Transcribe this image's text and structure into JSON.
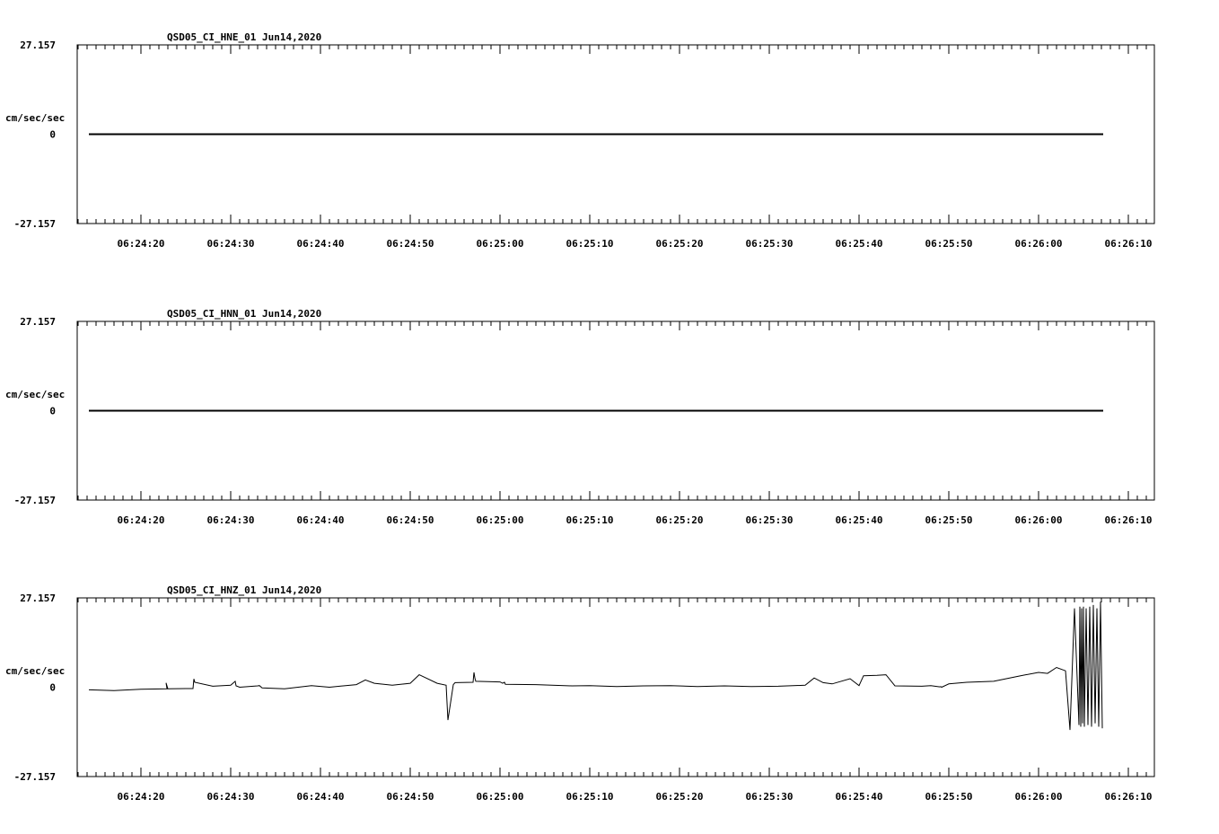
{
  "chart_data": [
    {
      "type": "line",
      "title": "QSD05_CI_HNE_01  Jun14,2020",
      "ylabel": "cm/sec/sec",
      "ylim": [
        -27.157,
        27.157
      ],
      "y_ticks": [
        "27.157",
        "0",
        "-27.157"
      ],
      "x_ticks": [
        "06:24:20",
        "06:24:30",
        "06:24:40",
        "06:24:50",
        "06:25:00",
        "06:25:10",
        "06:25:20",
        "06:25:30",
        "06:25:40",
        "06:25:50",
        "06:26:00",
        "06:26:10"
      ],
      "series": [
        {
          "x_sec": [
            -5.8,
            107.2
          ],
          "values": [
            0,
            0
          ]
        }
      ]
    },
    {
      "type": "line",
      "title": "QSD05_CI_HNN_01  Jun14,2020",
      "ylabel": "cm/sec/sec",
      "ylim": [
        -27.157,
        27.157
      ],
      "y_ticks": [
        "27.157",
        "0",
        "-27.157"
      ],
      "x_ticks": [
        "06:24:20",
        "06:24:30",
        "06:24:40",
        "06:24:50",
        "06:25:00",
        "06:25:10",
        "06:25:20",
        "06:25:30",
        "06:25:40",
        "06:25:50",
        "06:26:00",
        "06:26:10"
      ],
      "series": [
        {
          "x_sec": [
            -5.8,
            107.2
          ],
          "values": [
            0,
            0
          ]
        }
      ]
    },
    {
      "type": "line",
      "title": "QSD05_CI_HNZ_01  Jun14,2020",
      "ylabel": "cm/sec/sec",
      "ylim": [
        -27.157,
        27.157
      ],
      "y_ticks": [
        "27.157",
        "0",
        "-27.157"
      ],
      "x_ticks": [
        "06:24:20",
        "06:24:30",
        "06:24:40",
        "06:24:50",
        "06:25:00",
        "06:25:10",
        "06:25:20",
        "06:25:30",
        "06:25:40",
        "06:25:50",
        "06:26:00",
        "06:26:10"
      ],
      "series": [
        {
          "x_sec": [
            -5.8,
            -3.0,
            0.0,
            3.0,
            2.8,
            2.9,
            3.0,
            5.0,
            5.8,
            5.9,
            6.0,
            8.0,
            10.0,
            10.5,
            10.6,
            11.0,
            13.0,
            13.2,
            13.5,
            16.0,
            19.0,
            21.0,
            24.0,
            25.0,
            26.0,
            28.0,
            30.0,
            31.0,
            33.0,
            34.0,
            34.2,
            34.8,
            35.0,
            37.0,
            37.1,
            37.2,
            37.3,
            40.0,
            40.3,
            40.5,
            40.6,
            44.0,
            48.0,
            50.0,
            53.0,
            56.0,
            59.0,
            62.0,
            65.0,
            68.0,
            71.0,
            72.0,
            74.0,
            75.0,
            76.0,
            77.0,
            79.0,
            80.0,
            80.5,
            82.0,
            83.0,
            84.0,
            87.0,
            88.0,
            89.0,
            89.1,
            89.2,
            90.0,
            92.0,
            95.0,
            98.0,
            100.0,
            101.0,
            102.0,
            103.0,
            103.5,
            104.0,
            104.5,
            104.6,
            104.7,
            104.8,
            104.9,
            105.0,
            105.1,
            105.3,
            105.5,
            105.7,
            105.9,
            106.1,
            106.3,
            106.5,
            106.7,
            106.9,
            107.1
          ],
          "values": [
            -0.8,
            -1.0,
            -0.6,
            -0.5,
            1.3,
            -0.4,
            -0.5,
            -0.4,
            -0.4,
            2.5,
            1.5,
            0.3,
            0.6,
            1.8,
            0.4,
            0.0,
            0.4,
            0.5,
            -0.2,
            -0.5,
            0.5,
            0.0,
            0.8,
            2.2,
            1.2,
            0.6,
            1.2,
            3.8,
            1.2,
            0.6,
            -10.0,
            0.8,
            1.4,
            1.5,
            4.5,
            2.8,
            1.8,
            1.6,
            1.2,
            1.5,
            0.9,
            0.8,
            0.4,
            0.5,
            0.2,
            0.4,
            0.5,
            0.2,
            0.4,
            0.2,
            0.3,
            0.4,
            0.6,
            2.8,
            1.4,
            1.0,
            2.6,
            0.5,
            3.5,
            3.6,
            3.8,
            0.4,
            0.3,
            0.5,
            0.1,
            0.2,
            0.0,
            1.0,
            1.5,
            1.8,
            3.5,
            4.5,
            4.2,
            6.0,
            5.0,
            -13.0,
            24.0,
            -11.5,
            24.5,
            -12.0,
            24.0,
            -11.0,
            24.5,
            -12.0,
            24.0,
            -11.5,
            24.5,
            -12.0,
            25.0,
            -11.0,
            24.0,
            -12.0,
            26.0,
            -12.5
          ]
        }
      ]
    }
  ]
}
